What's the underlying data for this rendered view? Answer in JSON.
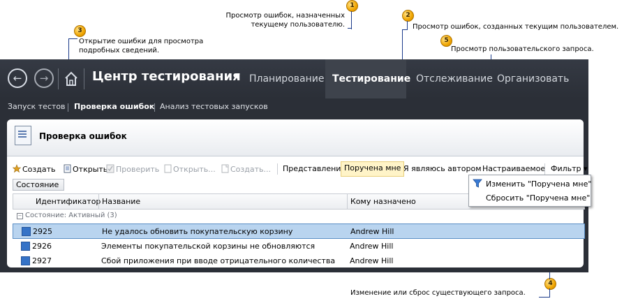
{
  "callouts": [
    {
      "num": "1",
      "text": "Просмотр ошибок, назначенных\nтекущему пользователю."
    },
    {
      "num": "2",
      "text": "Просмотр ошибок, созданных текущим пользователем."
    },
    {
      "num": "3",
      "text": "Открытие ошибки для просмотра\nподробных сведений."
    },
    {
      "num": "4",
      "text": "Изменение или сброс существующего запроса."
    },
    {
      "num": "5",
      "text": "Просмотр пользовательского запроса."
    }
  ],
  "header": {
    "back_glyph": "←",
    "forward_glyph": "→",
    "home_icon": "home-icon",
    "hub_title": "Центр тестирования",
    "hub_arrow": "▼",
    "tabs": [
      {
        "label": "Планирование"
      },
      {
        "label": "Тестирование"
      },
      {
        "label": "Отслеживание"
      },
      {
        "label": "Организовать"
      }
    ]
  },
  "subnav": {
    "items": [
      {
        "label": "Запуск тестов"
      },
      {
        "label": "Проверка ошибок"
      },
      {
        "label": "Анализ тестовых запусков"
      }
    ]
  },
  "page": {
    "title": "Проверка ошибок"
  },
  "toolbar": {
    "create": "Создать",
    "open": "Открыть",
    "verify": "Проверить",
    "open_dots": "Открыть...",
    "create_dots": "Создать...",
    "view_label": "Представление:",
    "view_assigned": "Поручена мне",
    "view_created": "Я являюсь автором",
    "view_custom": "Настраиваемое",
    "filter": "Фильтр",
    "filter_arrow": "▾"
  },
  "state_chip": "Состояние",
  "grid": {
    "columns": [
      "Идентификатор",
      "Название",
      "Кому назначено"
    ],
    "group_label": "Состояние: Активный (3)",
    "group_toggle": "−",
    "rows": [
      {
        "id": "2925",
        "title": "Не удалось обновить покупательскую корзину",
        "assigned": "Andrew Hill",
        "selected": true
      },
      {
        "id": "2926",
        "title": "Элементы покупательской корзины не обновляются",
        "assigned": "Andrew Hill",
        "selected": false
      },
      {
        "id": "2927",
        "title": "Сбой приложения при вводе отрицательного количества",
        "assigned": "Andrew Hill",
        "selected": false
      }
    ]
  },
  "filter_menu": {
    "edit": "Изменить \"Поручена мне\"",
    "reset": "Сбросить \"Поручена мне\""
  },
  "colors": {
    "callout_badge": "#f0a500",
    "callout_line": "#1a3a8a",
    "app_background": "#2b2f37",
    "selected_row": "#b9d4ef",
    "view_highlight": "#fff4c8",
    "work_item": "#3573c7"
  }
}
